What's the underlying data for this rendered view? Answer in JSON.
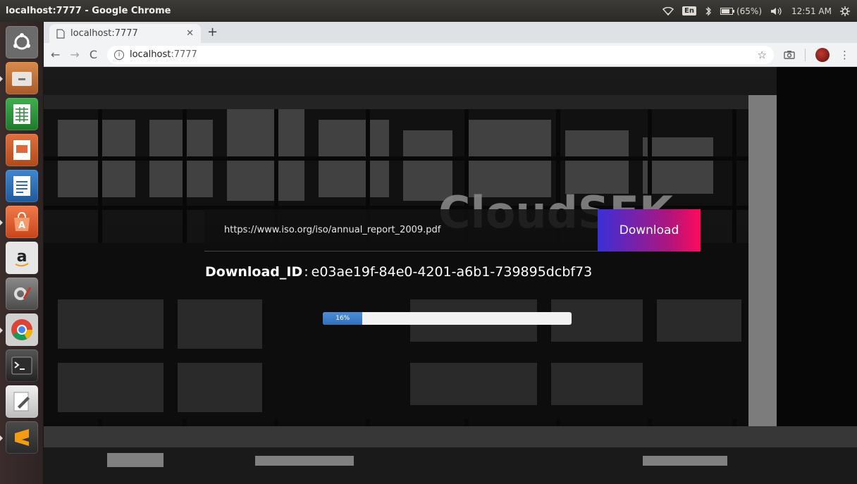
{
  "os_panel": {
    "window_title": "localhost:7777 - Google Chrome",
    "lang": "En",
    "battery": "(65%)",
    "clock": "12:51 AM"
  },
  "launcher": {
    "apps": [
      {
        "name": "ubuntu-dash",
        "color": "#7a7a7a"
      },
      {
        "name": "files",
        "color": "#c0743c"
      },
      {
        "name": "libreoffice-calc",
        "color": "#2f8a3b"
      },
      {
        "name": "libreoffice-impress",
        "color": "#c0552c"
      },
      {
        "name": "libreoffice-writer",
        "color": "#2f6db0"
      },
      {
        "name": "software-center",
        "color": "#e0673a"
      },
      {
        "name": "amazon",
        "color": "#d8d8d8"
      },
      {
        "name": "system-settings",
        "color": "#6a6a6a"
      },
      {
        "name": "chrome",
        "color": "#d8d8d8"
      },
      {
        "name": "terminal",
        "color": "#3a3a3a"
      },
      {
        "name": "text-editor",
        "color": "#dcdcdc"
      },
      {
        "name": "sublime-text",
        "color": "#e8a23a"
      }
    ]
  },
  "browser": {
    "tab_title": "localhost:7777",
    "address_host": "localhost",
    "address_port": ":7777"
  },
  "page": {
    "url_value": "https://www.iso.org/iso/annual_report_2009.pdf",
    "download_button": "Download",
    "download_id_label": "Download_ID",
    "download_id_sep": ":",
    "download_id_value": "e03ae19f-84e0-4201-a6b1-739895dcbf73",
    "progress_text": "16%",
    "progress_fraction": 0.16,
    "background_sign": "CloudSEK"
  }
}
